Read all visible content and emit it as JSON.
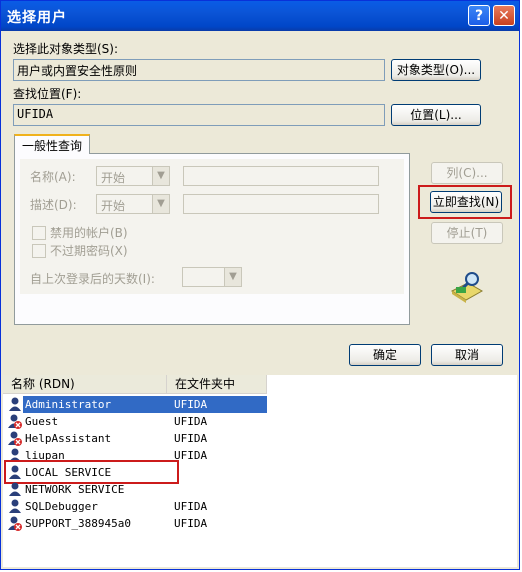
{
  "window": {
    "title": "选择用户",
    "help": "?",
    "close": "✕"
  },
  "object_type": {
    "label": "选择此对象类型(S):",
    "value": "用户或内置安全性原则",
    "button": "对象类型(O)..."
  },
  "location": {
    "label": "查找位置(F):",
    "value": "UFIDA",
    "button": "位置(L)..."
  },
  "tab": {
    "label": "一般性查询"
  },
  "query": {
    "name_label": "名称(A):",
    "name_mode": "开始",
    "desc_label": "描述(D):",
    "desc_mode": "开始",
    "disabled_accounts": "禁用的帐户(B)",
    "no_expire_pw": "不过期密码(X)",
    "days_label": "自上次登录后的天数(I):"
  },
  "side_buttons": {
    "columns": "列(C)...",
    "find_now": "立即查找(N)",
    "stop": "停止(T)"
  },
  "actions": {
    "ok": "确定",
    "cancel": "取消"
  },
  "results": {
    "columns": [
      "名称 (RDN)",
      "在文件夹中"
    ],
    "rows": [
      {
        "name": "Administrator",
        "folder": "UFIDA",
        "selected": true,
        "disabled": false
      },
      {
        "name": "Guest",
        "folder": "UFIDA",
        "selected": false,
        "disabled": true
      },
      {
        "name": "HelpAssistant",
        "folder": "UFIDA",
        "selected": false,
        "disabled": true
      },
      {
        "name": "liupan",
        "folder": "UFIDA",
        "selected": false,
        "disabled": false
      },
      {
        "name": "LOCAL SERVICE",
        "folder": "",
        "selected": false,
        "disabled": false
      },
      {
        "name": "NETWORK SERVICE",
        "folder": "",
        "selected": false,
        "disabled": false
      },
      {
        "name": "SQLDebugger",
        "folder": "UFIDA",
        "selected": false,
        "disabled": false
      },
      {
        "name": "SUPPORT_388945a0",
        "folder": "UFIDA",
        "selected": false,
        "disabled": true
      }
    ]
  },
  "colors": {
    "titlebar": "#0054e3",
    "highlight_box": "#cc1b1b",
    "selection": "#316ac5"
  }
}
